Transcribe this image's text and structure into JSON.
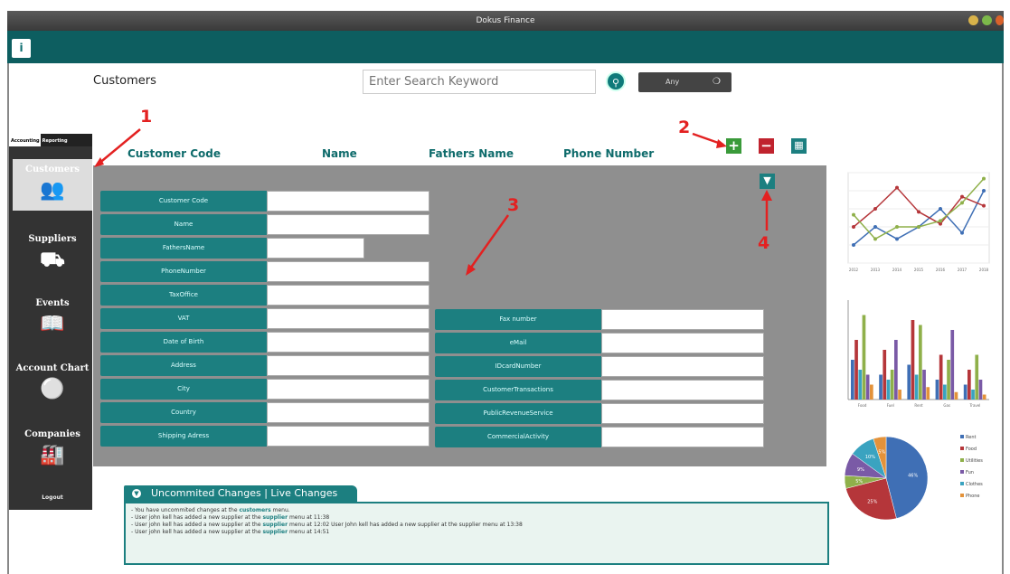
{
  "window": {
    "title": "Dokus Finance"
  },
  "header": {
    "page_title": "Customers",
    "search_placeholder": "Enter Search Keyword",
    "scope": "Any"
  },
  "sidebar": {
    "tabs": [
      "Accounting",
      "Reporting"
    ],
    "items": [
      {
        "label": "Customers",
        "icon": "customers-icon"
      },
      {
        "label": "Suppliers",
        "icon": "truck-icon"
      },
      {
        "label": "Events",
        "icon": "calendar-icon"
      },
      {
        "label": "Account Chart",
        "icon": "chart-icon"
      },
      {
        "label": "Companies",
        "icon": "factory-icon"
      }
    ],
    "logout": "Logout"
  },
  "table": {
    "columns": [
      "Customer Code",
      "Name",
      "Fathers Name",
      "Phone Number"
    ]
  },
  "form": {
    "left": [
      "Customer Code",
      "Name",
      "FathersName",
      "PhoneNumber",
      "TaxOffice",
      "VAT",
      "Date of Birth",
      "Address",
      "City",
      "Country",
      "Shipping Adress"
    ],
    "right": [
      "Fax number",
      "eMail",
      "IDcardNumber",
      "CustomerTransactions",
      "PublicRevenueService",
      "CommercialActivity"
    ]
  },
  "changes": {
    "tab1": "Uncommited Changes",
    "tab2": "Live Changes",
    "lines": [
      [
        "- You have uncommited changes at the ",
        "customers",
        " menu."
      ],
      [
        "- User john kell has added a new supplier at the ",
        "supplier",
        " menu at 11:38"
      ],
      [
        "- User john kell has added a new supplier at the ",
        "supplier",
        " menu at 12:02 User John kell has added a new supplier at the supplier menu at 13:38"
      ],
      [
        "- User john kell has added a new supplier at the ",
        "supplier",
        " menu at 14:51"
      ]
    ]
  },
  "annotations": [
    "1",
    "2",
    "3",
    "4"
  ],
  "colors": {
    "teal": "#1c7f80",
    "dark_teal": "#0d5e60",
    "red": "#e32121",
    "panel_gray": "#8f8f8f"
  },
  "chart_data": [
    {
      "type": "line",
      "x": [
        "2012",
        "2013",
        "2014",
        "2015",
        "2016",
        "2017",
        "2018"
      ],
      "series": [
        {
          "values": [
            30,
            60,
            40,
            60,
            90,
            50,
            120
          ]
        },
        {
          "values": [
            60,
            90,
            125,
            85,
            65,
            110,
            95
          ]
        },
        {
          "values": [
            80,
            40,
            60,
            60,
            70,
            100,
            140
          ]
        }
      ],
      "ylim": [
        0,
        150
      ]
    },
    {
      "type": "bar",
      "categories": [
        "Food",
        "Fuel",
        "Rent",
        "Gas",
        "Travel"
      ],
      "series": [
        {
          "values": [
            80,
            50,
            70,
            40,
            30
          ]
        },
        {
          "values": [
            120,
            100,
            160,
            90,
            60
          ]
        },
        {
          "values": [
            60,
            40,
            50,
            30,
            20
          ]
        },
        {
          "values": [
            170,
            60,
            150,
            80,
            90
          ]
        },
        {
          "values": [
            50,
            120,
            60,
            140,
            40
          ]
        },
        {
          "values": [
            30,
            20,
            25,
            15,
            10
          ]
        }
      ],
      "ylim": [
        0,
        200
      ]
    },
    {
      "type": "pie",
      "labels": [
        "Rent",
        "Food",
        "Utilities",
        "Fun",
        "Clothes",
        "Phone"
      ],
      "values": [
        46,
        25,
        5,
        9,
        10,
        5
      ],
      "colors": [
        "#3f6fb5",
        "#b5363a",
        "#8fb04a",
        "#7a5aa6",
        "#3aa3c0",
        "#e3923a"
      ]
    }
  ]
}
